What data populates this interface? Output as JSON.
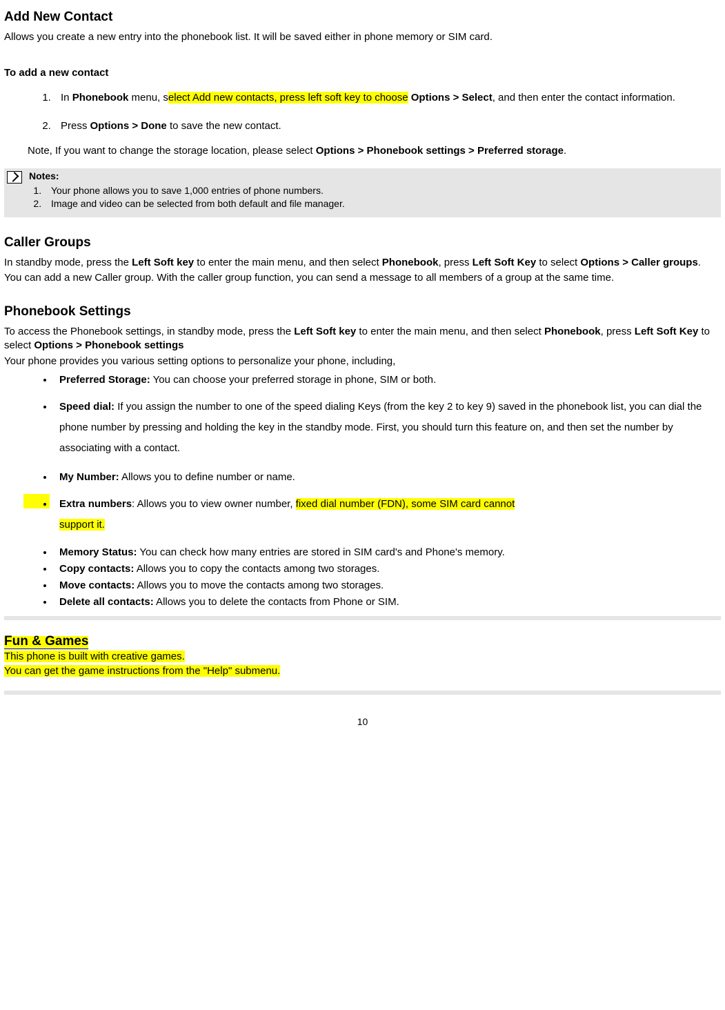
{
  "s1": {
    "heading": "Add New Contact",
    "intro": "Allows you create a new entry into the phonebook list. It will be saved either in phone memory or SIM card.",
    "sub": "To add a new contact",
    "step1_a": "In ",
    "step1_b": "Phonebook",
    "step1_c": " menu, s",
    "step1_hl": "elect Add new contacts, press left soft key to choose",
    "step1_d": " ",
    "step1_e": "Options > Select",
    "step1_f": ", and then enter the contact information.",
    "step2_a": "Press ",
    "step2_b": "Options > Done",
    "step2_c": " to save the new contact.",
    "note_a": "Note, If you want to change the storage location, please select ",
    "note_b": "Options > Phonebook settings > Preferred storage",
    "note_c": ".",
    "box_title": "Notes:",
    "box_1": "Your phone allows you to save 1,000 entries of phone numbers.",
    "box_2": "Image and video can be selected from both default and file manager."
  },
  "s2": {
    "heading": "Caller Groups",
    "p1_a": "In standby mode, press the ",
    "p1_b": "Left Soft key",
    "p1_c": " to enter the main menu, and then select ",
    "p1_d": "Phonebook",
    "p1_e": ", press ",
    "p1_f": "Left Soft Key",
    "p1_g": " to select ",
    "p1_h": "Options > Caller groups",
    "p1_i": ".",
    "p2": "You can add a new Caller group. With the caller group function, you can send a message to all members of a group at the same time."
  },
  "s3": {
    "heading": "Phonebook Settings",
    "p1_a": "To access the Phonebook settings, in standby mode, press the ",
    "p1_b": "Left Soft key",
    "p1_c": " to enter the main menu, and then select ",
    "p1_d": "Phonebook",
    "p1_e": ", press ",
    "p1_f": "Left Soft Key",
    "p1_g": " to select ",
    "p1_h": "Options > Phonebook settings",
    "p2": "Your phone provides you various setting options to personalize your phone, including,",
    "b1_t": "Preferred Storage:",
    "b1": " You can choose your preferred storage in phone, SIM or both.",
    "b2_t": "Speed dial:",
    "b2": " If you assign the number to one of the speed dialing Keys (from the key 2 to key 9) saved in the phonebook list, you can dial the phone number by pressing and holding the key in the standby mode. First, you should turn this feature on, and then set the number by associating with a contact.",
    "b3_t": "My Number:",
    "b3": " Allows you to define number or name.",
    "b4_t": "Extra numbers",
    "b4_a": ": Allows you to view owner number, ",
    "b4_hl1": "fixed dial number (FDN), some SIM card cannot",
    "b4_hl2": "support it.",
    "b5_t": "Memory Status:",
    "b5": " You can check how many entries are stored in SIM card's and Phone's memory.",
    "b6_t": "Copy contacts:",
    "b6": " Allows you to copy the contacts among two storages.",
    "b7_t": "Move contacts:",
    "b7": " Allows you to move the contacts among two storages.",
    "b8_t": "Delete all contacts:",
    "b8": " Allows you to delete the contacts from Phone or SIM."
  },
  "s4": {
    "heading": "Fun & Games",
    "l1": "This phone is built with creative games.",
    "l2": "You can get the game instructions from the \"Help\" submenu."
  },
  "page": "10"
}
